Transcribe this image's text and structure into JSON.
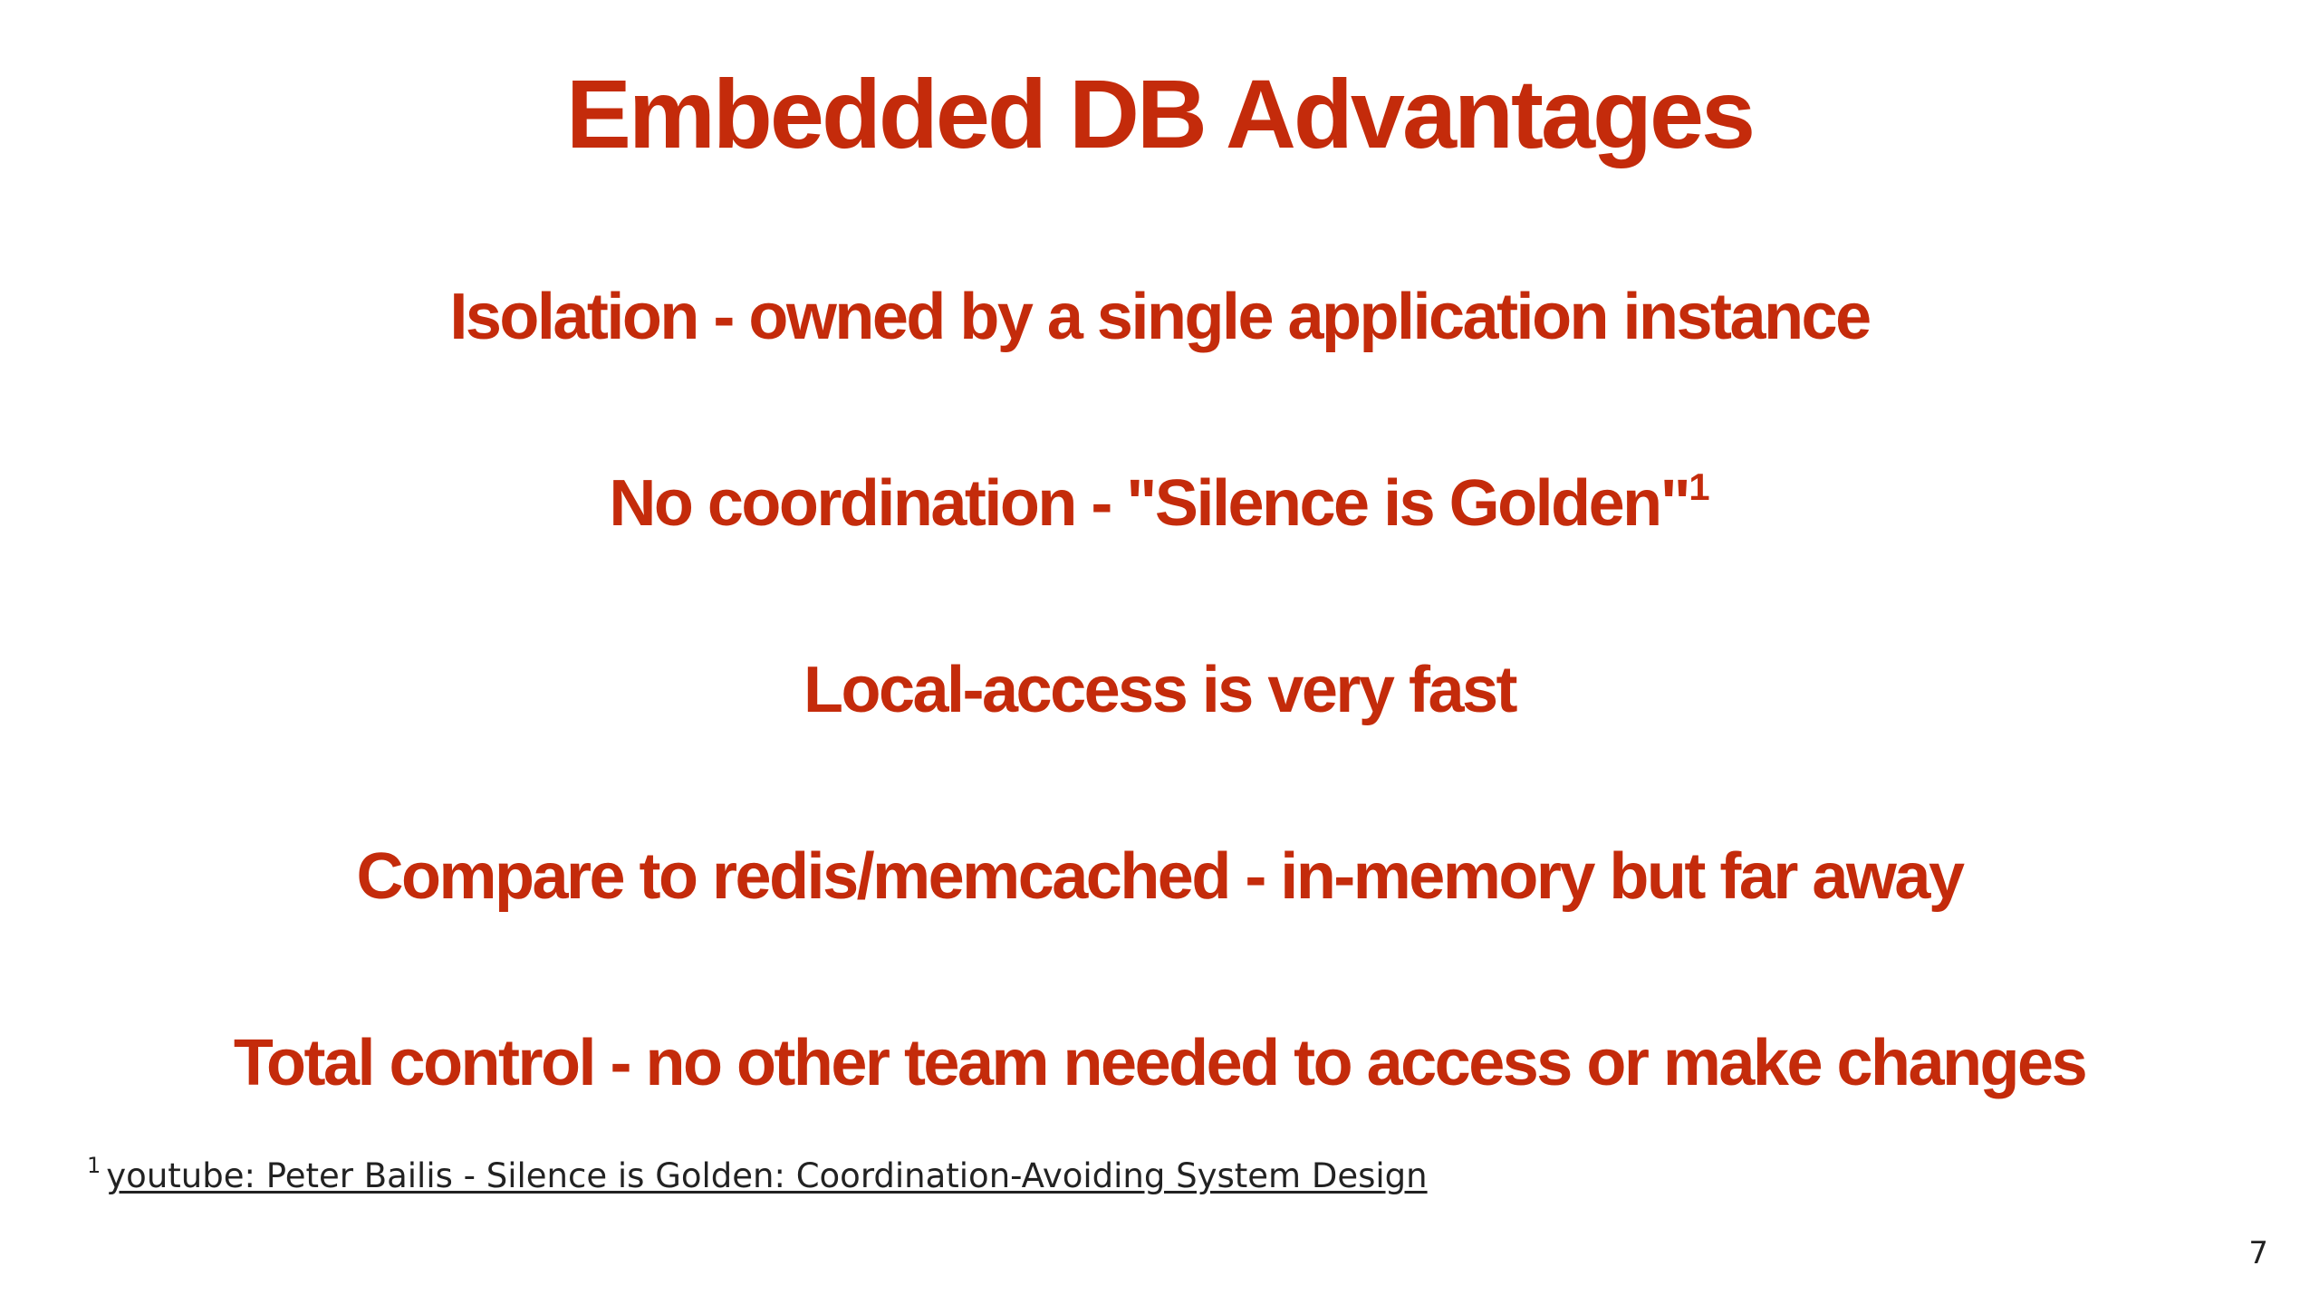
{
  "slide": {
    "title": "Embedded DB Advantages",
    "bullets": [
      {
        "text": "Isolation - owned by a single application instance",
        "sup": ""
      },
      {
        "text": "No coordination - \"Silence is Golden\"",
        "sup": "1"
      },
      {
        "text": "Local-access is very fast",
        "sup": ""
      },
      {
        "text": "Compare to redis/memcached - in-memory but far away",
        "sup": ""
      },
      {
        "text": "Total control - no other team needed to access or make changes",
        "sup": ""
      }
    ],
    "footnote": {
      "marker": "1",
      "link_text": "youtube: Peter Bailis - Silence is Golden: Coordination-Avoiding System Design"
    },
    "page_number": "7",
    "colors": {
      "accent": "#c42b0b",
      "text": "#222222",
      "background": "#ffffff"
    }
  }
}
